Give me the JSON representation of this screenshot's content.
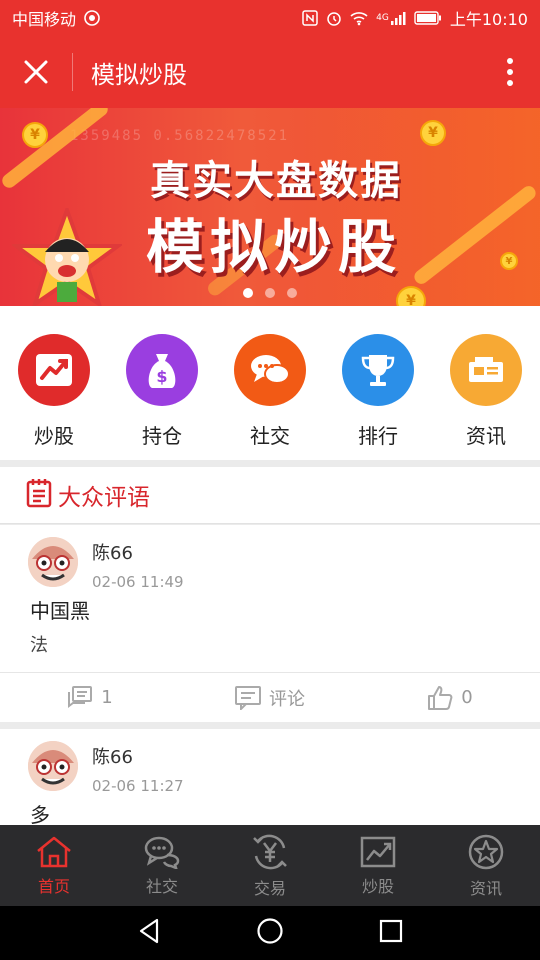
{
  "status_bar": {
    "carrier": "中国移动",
    "network": "4G",
    "time": "上午10:10"
  },
  "header": {
    "title": "模拟炒股"
  },
  "banner": {
    "line1": "真实大盘数据",
    "line2": "模拟炒股",
    "numbers": "1359485 0.56822478521",
    "slide_count": 3,
    "active_slide": 1
  },
  "quick_menu": [
    {
      "label": "炒股",
      "icon": "stock-trend-icon",
      "color": "#e02b2b"
    },
    {
      "label": "持仓",
      "icon": "money-bag-icon",
      "color": "#9a3ee0"
    },
    {
      "label": "社交",
      "icon": "chat-bubbles-icon",
      "color": "#f25a15"
    },
    {
      "label": "排行",
      "icon": "trophy-icon",
      "color": "#2b8fe8"
    },
    {
      "label": "资讯",
      "icon": "news-icon",
      "color": "#f7a934"
    }
  ],
  "section": {
    "title": "大众评语",
    "icon": "notepad-icon",
    "accent": "#d8262c"
  },
  "posts": [
    {
      "user": "陈66",
      "time": "02-06 11:49",
      "title": "中国黑",
      "body": "法",
      "comment_count": "1",
      "comment_label": "评论",
      "like_count": "0"
    },
    {
      "user": "陈66",
      "time": "02-06 11:27",
      "title": "多"
    }
  ],
  "bottom_nav": [
    {
      "label": "首页",
      "icon": "home-icon",
      "active": true
    },
    {
      "label": "社交",
      "icon": "chat-icon",
      "active": false
    },
    {
      "label": "交易",
      "icon": "yen-exchange-icon",
      "active": false
    },
    {
      "label": "炒股",
      "icon": "chart-icon",
      "active": false
    },
    {
      "label": "资讯",
      "icon": "star-icon",
      "active": false
    }
  ],
  "colors": {
    "brand_red": "#e8322e",
    "nav_dark": "#2b2b2d"
  }
}
